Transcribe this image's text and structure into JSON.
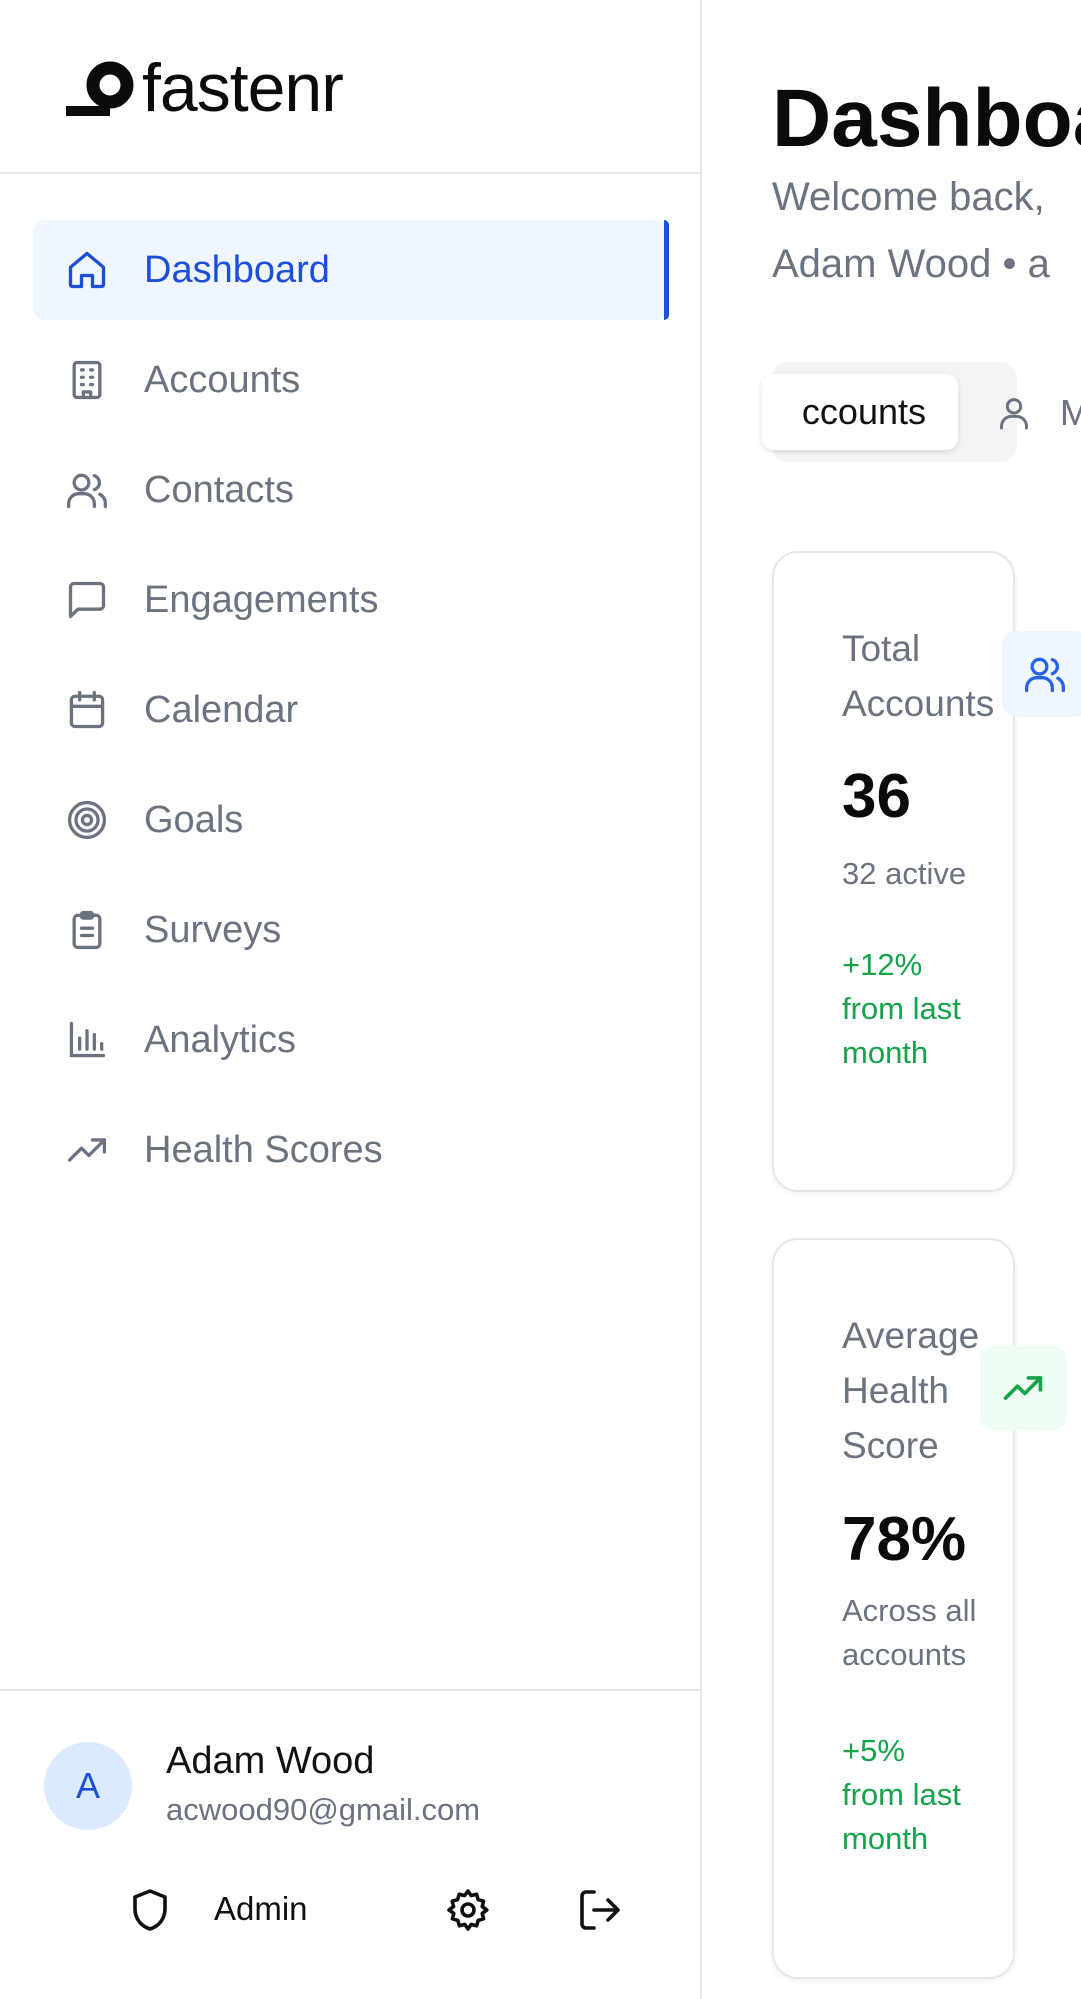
{
  "brand": {
    "name": "fastenr"
  },
  "sidebar": {
    "items": [
      {
        "label": "Dashboard",
        "icon": "home-icon",
        "active": true
      },
      {
        "label": "Accounts",
        "icon": "building-icon"
      },
      {
        "label": "Contacts",
        "icon": "users-icon"
      },
      {
        "label": "Engagements",
        "icon": "message-square-icon"
      },
      {
        "label": "Calendar",
        "icon": "calendar-icon"
      },
      {
        "label": "Goals",
        "icon": "target-icon"
      },
      {
        "label": "Surveys",
        "icon": "clipboard-icon"
      },
      {
        "label": "Analytics",
        "icon": "bar-chart-icon"
      },
      {
        "label": "Health Scores",
        "icon": "trending-up-icon"
      }
    ],
    "accent_color": "#1d4ed8"
  },
  "user": {
    "initial": "A",
    "name": "Adam Wood",
    "email": "acwood90@gmail.com",
    "role": "Admin"
  },
  "main": {
    "title": "Dashboa",
    "subtitle_line1": "Welcome back,",
    "subtitle_line2": "Adam Wood • a",
    "tabs": [
      {
        "label": "ccounts",
        "active": true
      },
      {
        "label": "My Ac",
        "icon": "user-icon"
      }
    ],
    "cards": [
      {
        "label": "Total Accounts",
        "value": "36",
        "sub": "32 active",
        "trend": "+12% from last month",
        "icon": "users-icon",
        "icon_color": "#2563eb"
      },
      {
        "label": "Average Health Score",
        "value": "78%",
        "sub": "Across all accounts",
        "trend": "+5% from last month",
        "icon": "trending-up-icon",
        "icon_color": "#16a34a"
      }
    ]
  }
}
